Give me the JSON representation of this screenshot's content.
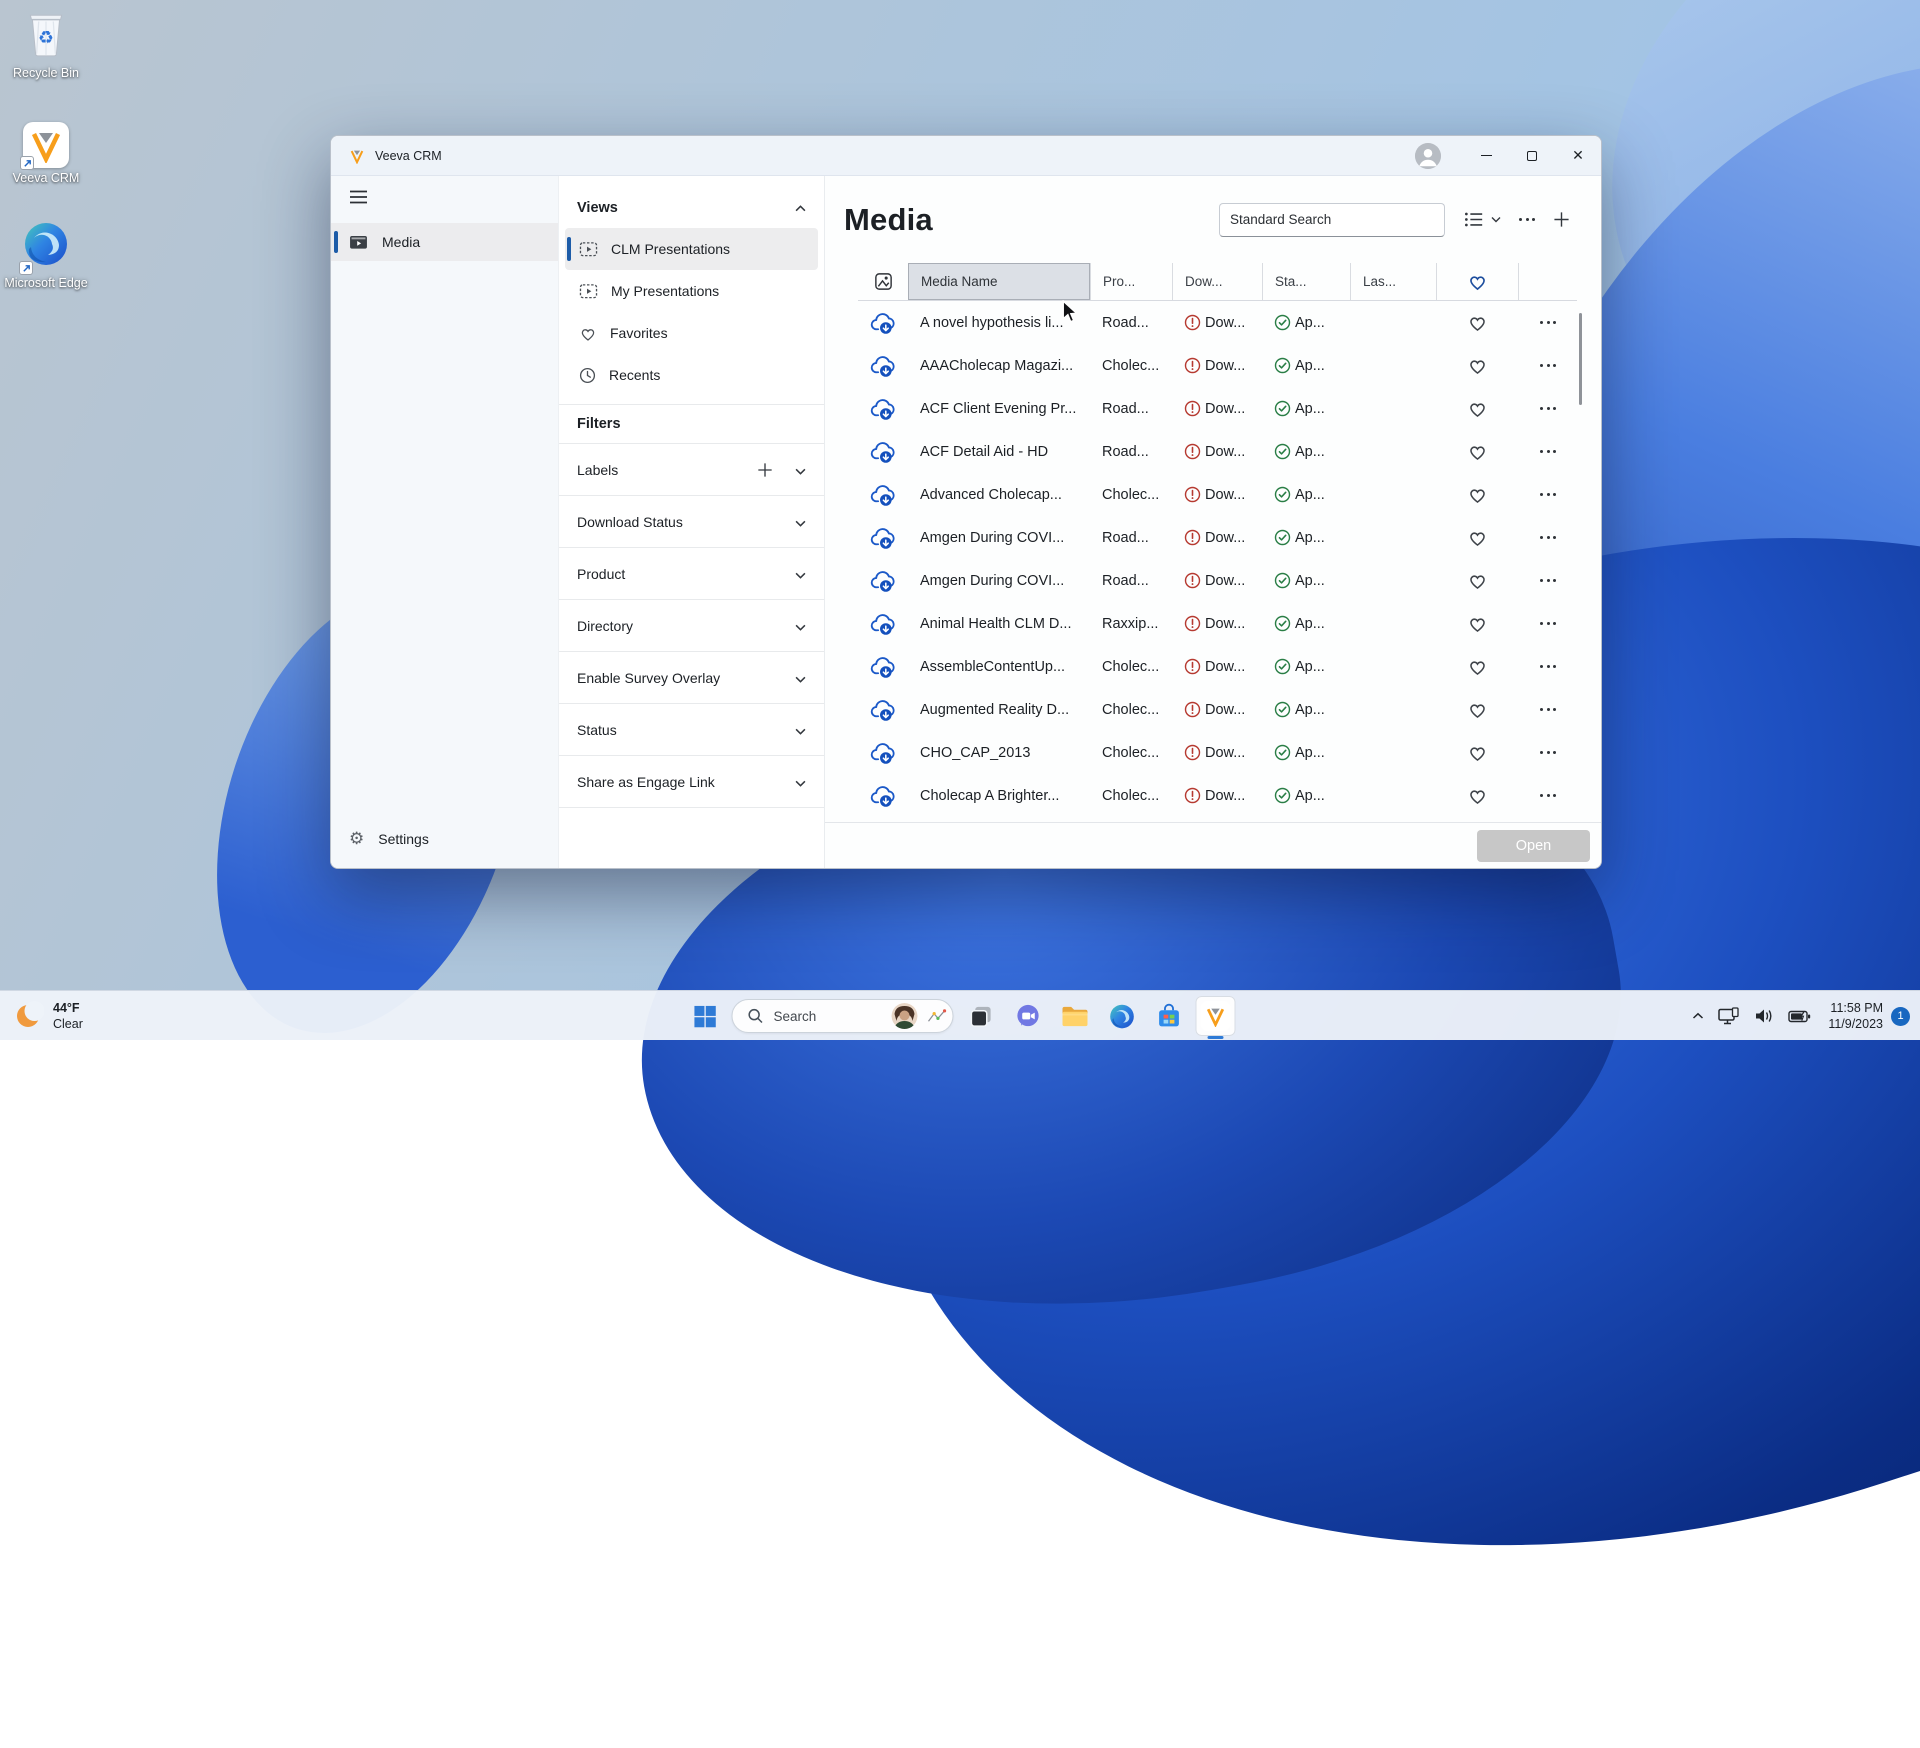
{
  "desktop": {
    "icons": [
      {
        "label": "Recycle Bin",
        "icon": "recycle-bin-icon"
      },
      {
        "label": "Veeva CRM",
        "icon": "veeva-crm-icon"
      },
      {
        "label": "Microsoft Edge",
        "icon": "edge-icon"
      }
    ],
    "weather": {
      "temperature": "44°F",
      "condition": "Clear"
    }
  },
  "window": {
    "title": "Veeva CRM",
    "nav": {
      "media": "Media",
      "settings": "Settings"
    },
    "views": {
      "header": "Views",
      "items": [
        {
          "label": "CLM Presentations",
          "icon": "presentation-icon",
          "selected": true
        },
        {
          "label": "My Presentations",
          "icon": "presentation-icon",
          "selected": false
        },
        {
          "label": "Favorites",
          "icon": "heart-icon",
          "selected": false
        },
        {
          "label": "Recents",
          "icon": "clock-icon",
          "selected": false
        }
      ]
    },
    "filters": {
      "header": "Filters",
      "items": [
        {
          "label": "Labels",
          "has_add": true
        },
        {
          "label": "Download Status",
          "has_add": false
        },
        {
          "label": "Product",
          "has_add": false
        },
        {
          "label": "Directory",
          "has_add": false
        },
        {
          "label": "Enable Survey Overlay",
          "has_add": false
        },
        {
          "label": "Status",
          "has_add": false
        },
        {
          "label": "Share as Engage Link",
          "has_add": false
        }
      ]
    },
    "main": {
      "title": "Media",
      "search_value": "Standard Search",
      "columns": {
        "media_name": "Media Name",
        "product": "Pro...",
        "download": "Dow...",
        "status": "Sta...",
        "last": "Las..."
      },
      "rows": [
        {
          "name": "A novel hypothesis li...",
          "product": "Road...",
          "download": "Dow...",
          "status": "Ap..."
        },
        {
          "name": "AAACholecap Magazi...",
          "product": "Cholec...",
          "download": "Dow...",
          "status": "Ap..."
        },
        {
          "name": "ACF Client Evening Pr...",
          "product": "Road...",
          "download": "Dow...",
          "status": "Ap..."
        },
        {
          "name": "ACF Detail Aid - HD",
          "product": "Road...",
          "download": "Dow...",
          "status": "Ap..."
        },
        {
          "name": "Advanced Cholecap...",
          "product": "Cholec...",
          "download": "Dow...",
          "status": "Ap..."
        },
        {
          "name": "Amgen During COVI...",
          "product": "Road...",
          "download": "Dow...",
          "status": "Ap..."
        },
        {
          "name": "Amgen During COVI...",
          "product": "Road...",
          "download": "Dow...",
          "status": "Ap..."
        },
        {
          "name": "Animal Health CLM D...",
          "product": "Raxxip...",
          "download": "Dow...",
          "status": "Ap..."
        },
        {
          "name": "AssembleContentUp...",
          "product": "Cholec...",
          "download": "Dow...",
          "status": "Ap..."
        },
        {
          "name": "Augmented Reality D...",
          "product": "Cholec...",
          "download": "Dow...",
          "status": "Ap..."
        },
        {
          "name": "CHO_CAP_2013",
          "product": "Cholec...",
          "download": "Dow...",
          "status": "Ap..."
        },
        {
          "name": "Cholecap A Brighter...",
          "product": "Cholec...",
          "download": "Dow...",
          "status": "Ap..."
        }
      ],
      "open_button": "Open"
    }
  },
  "taskbar": {
    "search_label": "Search",
    "tray": {
      "time": "11:58 PM",
      "date": "11/9/2023",
      "badge": "1"
    }
  },
  "icons": {
    "hamburger-icon": "☰",
    "search-icon": "🔍",
    "plus-icon": "+",
    "more-icon": "•••",
    "chevron-up-icon": "^",
    "chevron-down-icon": "v",
    "list-view-icon": "≡",
    "cloud-download-icon": "cloud+arrow",
    "alert-icon": "(!)",
    "check-icon": "(✓)",
    "favorite-heart-icon": "♡",
    "gear-icon": "⚙",
    "recycle-icon": "♻"
  },
  "colors": {
    "accent_blue": "#1d5ca8",
    "cloud_blue": "#1450bd",
    "alert_red": "#b63a31",
    "success_green": "#2a7e46",
    "heart_header_blue": "#1d4e9e",
    "badge_blue": "#1867c0",
    "open_button_gray": "#c7c7c7"
  }
}
